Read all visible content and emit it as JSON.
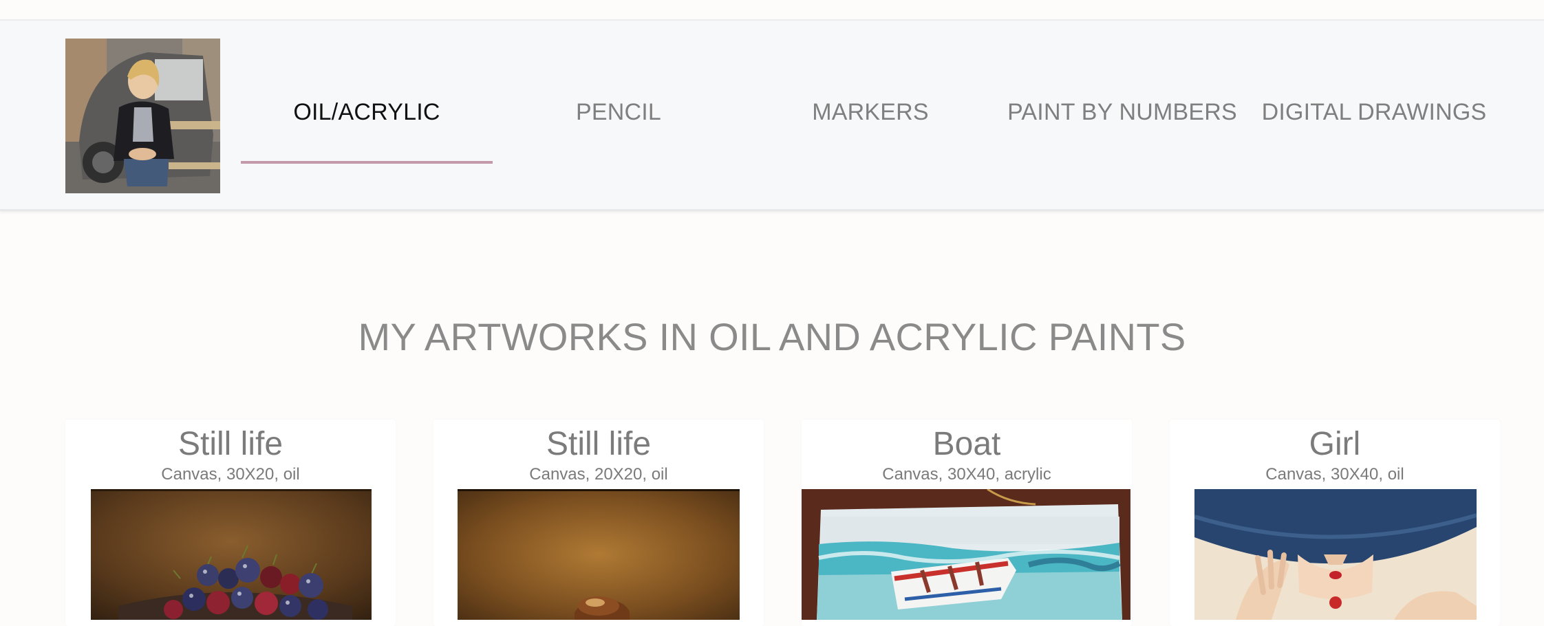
{
  "nav": {
    "items": [
      {
        "label": "OIL/ACRYLIC",
        "active": true
      },
      {
        "label": "PENCIL",
        "active": false
      },
      {
        "label": "MARKERS",
        "active": false
      },
      {
        "label": "PAINT BY NUMBERS",
        "active": false
      },
      {
        "label": "DIGITAL DRAWINGS",
        "active": false
      }
    ]
  },
  "main": {
    "title": "MY ARTWORKS IN OIL AND ACRYLIC PAINTS",
    "artworks": [
      {
        "title": "Still life",
        "details": "Canvas, 30X20, oil",
        "image": "cherries-painting"
      },
      {
        "title": "Still life",
        "details": "Canvas, 20X20, oil",
        "image": "still-life-painting"
      },
      {
        "title": "Boat",
        "details": "Canvas, 30X40, acrylic",
        "image": "boat-painting"
      },
      {
        "title": "Girl",
        "details": "Canvas, 30X40, oil",
        "image": "girl-in-hat-painting"
      }
    ]
  },
  "colors": {
    "accent_underline": "#c49aab",
    "header_bg": "#f7f8fa",
    "page_bg": "#fdfcfb",
    "text_gray": "#7f7f7f"
  }
}
